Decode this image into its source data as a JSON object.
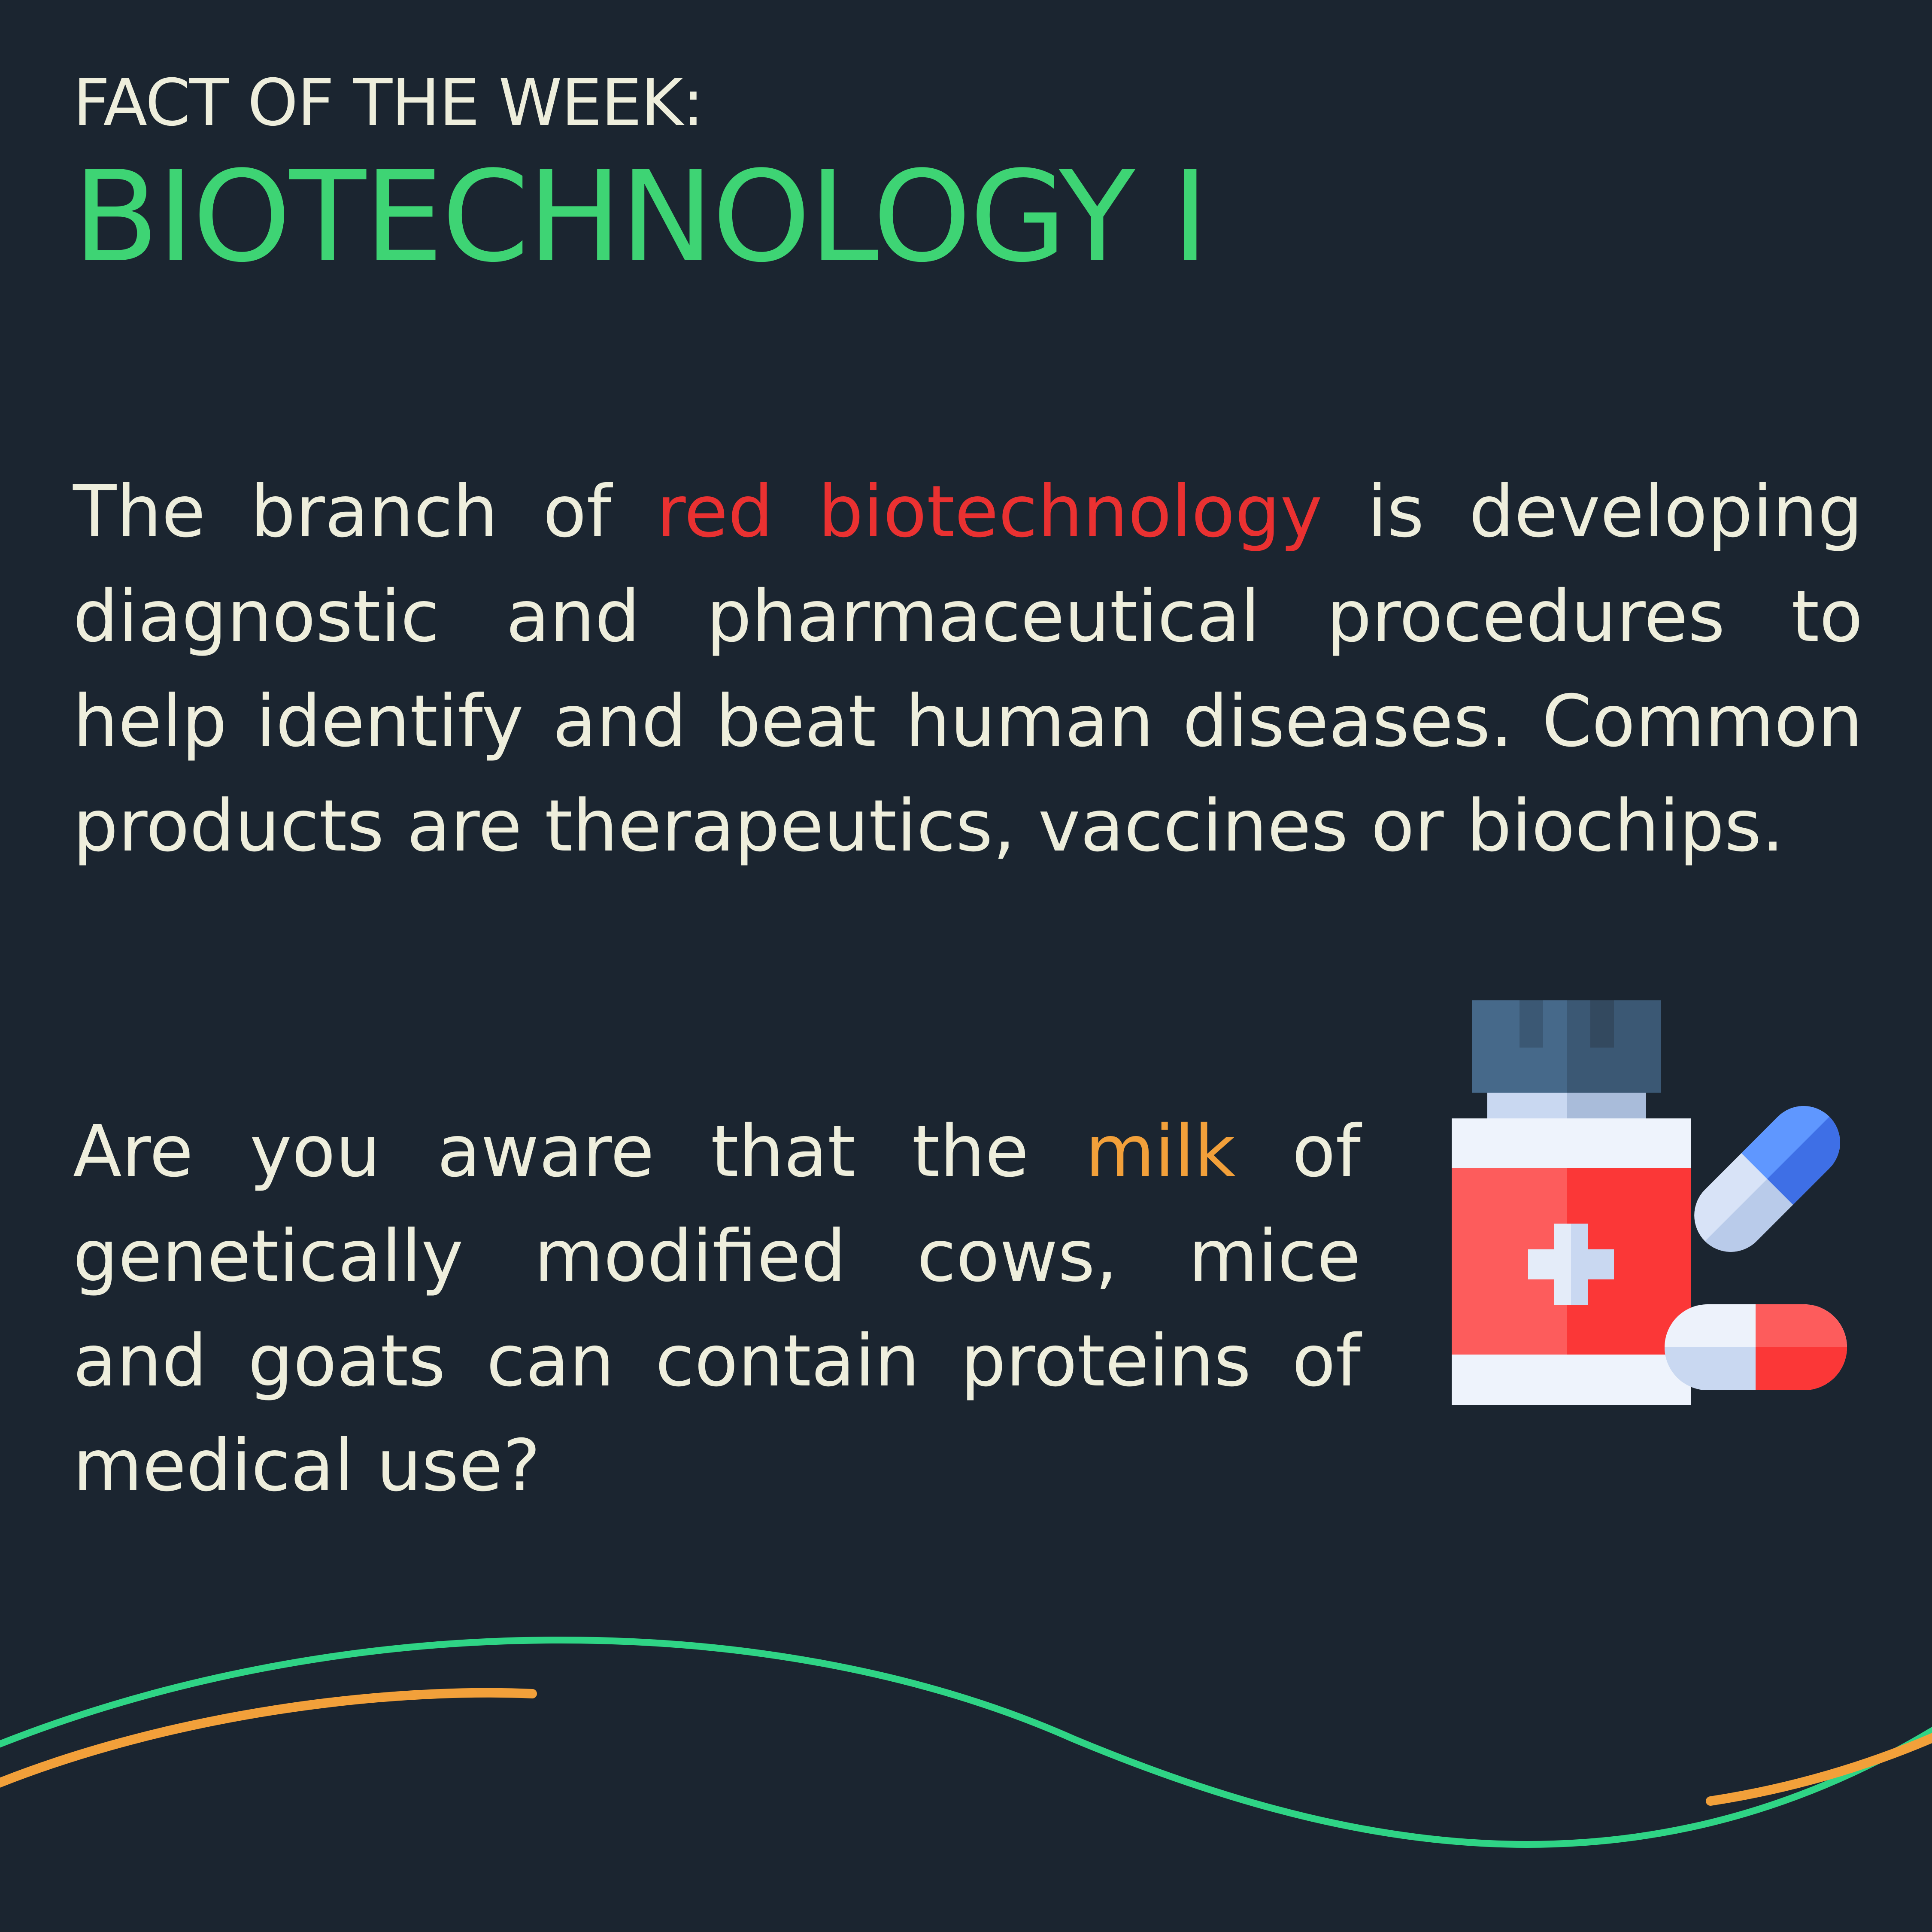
{
  "header": {
    "kicker": "FACT OF THE WEEK:",
    "title": "BIOTECHNOLOGY I"
  },
  "paragraph1": {
    "before": "The branch of ",
    "highlight": "red biotechnology",
    "after": " is developing diagnostic and pharmaceutical procedures to help identify and beat human diseases. Common products are therapeutics, vaccines or biochips."
  },
  "paragraph2": {
    "before": "Are you aware that the ",
    "highlight": "milk",
    "after": " of genetically modified cows, mice and goats can contain proteins of medical use?"
  },
  "icons": {
    "illustration": "medicine-bottle-and-capsules-icon"
  },
  "colors": {
    "background": "#1b2530",
    "text": "#eeeedc",
    "title_green": "#3ed474",
    "highlight_red": "#ea3131",
    "highlight_orange": "#f2a03a",
    "wave_green": "#2fd485",
    "wave_orange": "#f2a03a"
  }
}
